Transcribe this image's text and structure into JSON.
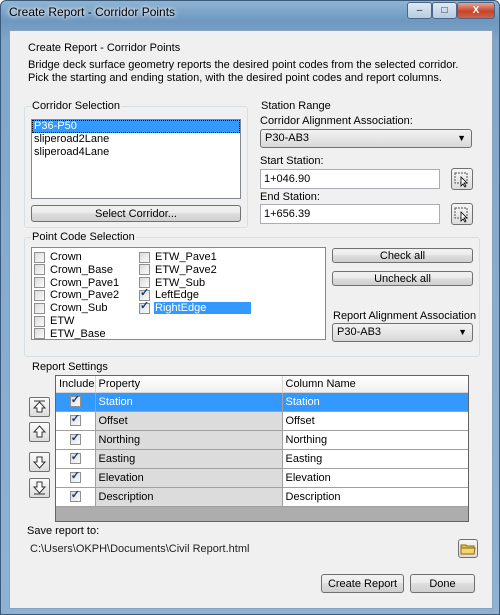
{
  "window": {
    "title": "Create Report - Corridor Points",
    "min_glyph": "–",
    "max_glyph": "□",
    "close_glyph": "X"
  },
  "header": {
    "title": "Create Report - Corridor Points",
    "description": "Bridge deck surface geometry reports the desired point codes from the selected corridor.  Pick the starting and ending station, with the desired point codes and report columns."
  },
  "corridor_selection": {
    "label": "Corridor Selection",
    "items": [
      {
        "label": "P36-P50",
        "selected": true
      },
      {
        "label": "sliperoad2Lane",
        "selected": false
      },
      {
        "label": "sliperoad4Lane",
        "selected": false
      }
    ],
    "select_button": "Select Corridor..."
  },
  "station_range": {
    "label": "Station Range",
    "alignment_label": "Corridor Alignment Association:",
    "alignment_value": "P30-AB3",
    "start_label": "Start Station:",
    "start_value": "1+046.90",
    "end_label": "End Station:",
    "end_value": "1+656.39"
  },
  "point_codes": {
    "label": "Point Code Selection",
    "column1": [
      {
        "label": "Crown",
        "checked": false
      },
      {
        "label": "Crown_Base",
        "checked": false
      },
      {
        "label": "Crown_Pave1",
        "checked": false
      },
      {
        "label": "Crown_Pave2",
        "checked": false
      },
      {
        "label": "Crown_Sub",
        "checked": false
      },
      {
        "label": "ETW",
        "checked": false
      },
      {
        "label": "ETW_Base",
        "checked": false
      }
    ],
    "column2": [
      {
        "label": "ETW_Pave1",
        "checked": false
      },
      {
        "label": "ETW_Pave2",
        "checked": false
      },
      {
        "label": "ETW_Sub",
        "checked": false
      },
      {
        "label": "LeftEdge",
        "checked": true
      },
      {
        "label": "RightEdge",
        "checked": true,
        "selected": true
      }
    ],
    "check_all": "Check all",
    "uncheck_all": "Uncheck all",
    "report_alignment_label": "Report Alignment Association",
    "report_alignment_value": "P30-AB3"
  },
  "report_settings": {
    "label": "Report Settings",
    "columns": [
      "Include",
      "Property",
      "Column Name"
    ],
    "rows": [
      {
        "include": true,
        "property": "Station",
        "column_name": "Station",
        "selected": true
      },
      {
        "include": true,
        "property": "Offset",
        "column_name": "Offset"
      },
      {
        "include": true,
        "property": "Northing",
        "column_name": "Northing"
      },
      {
        "include": true,
        "property": "Easting",
        "column_name": "Easting"
      },
      {
        "include": true,
        "property": "Elevation",
        "column_name": "Elevation"
      },
      {
        "include": true,
        "property": "Description",
        "column_name": "Description"
      }
    ]
  },
  "save": {
    "label": "Save report to:",
    "path": "C:\\Users\\OKPH\\Documents\\Civil Report.html"
  },
  "footer": {
    "create_button": "Create Report",
    "done_button": "Done"
  }
}
